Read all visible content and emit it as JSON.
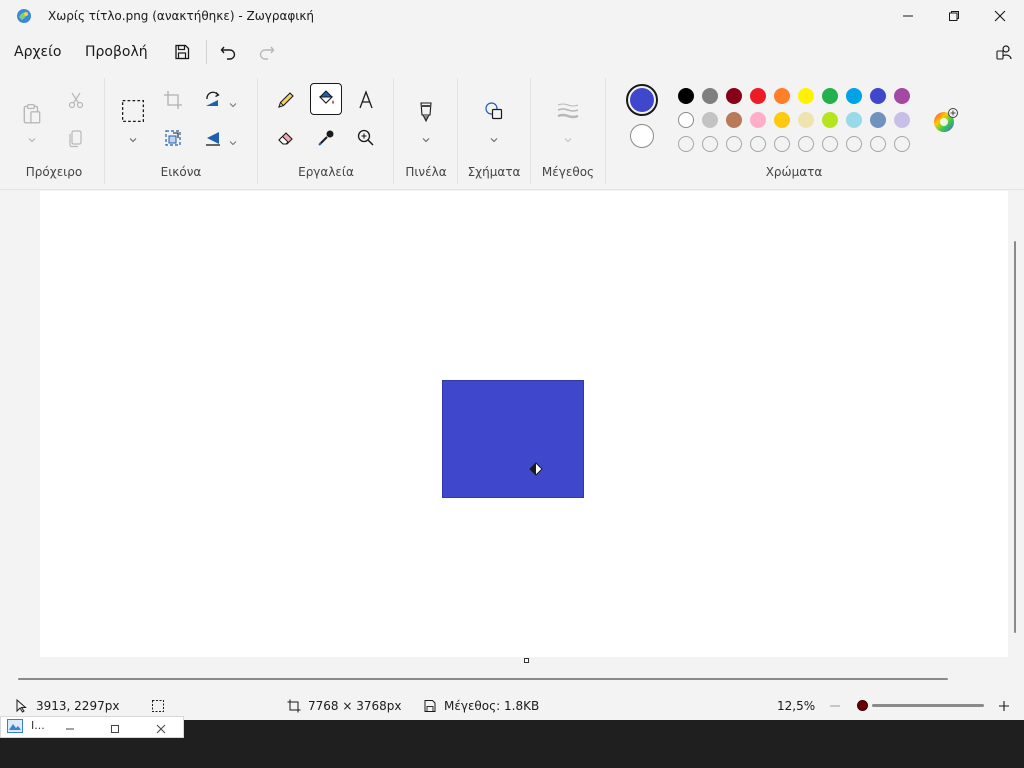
{
  "window": {
    "title": "Χωρίς τίτλο.png (ανακτήθηκε) - Ζωγραφική",
    "icons": {
      "app": "paint-app-icon",
      "minimize": "minimize-icon",
      "maximize": "restore-icon",
      "close": "close-icon"
    }
  },
  "menubar": {
    "items": [
      {
        "label": "Αρχείο"
      },
      {
        "label": "Προβολή"
      }
    ],
    "quick_actions": [
      "save-icon",
      "undo-icon",
      "redo-icon"
    ],
    "account_icon": "account-settings-icon"
  },
  "ribbon": {
    "groups": [
      {
        "label": "Πρόχειρο"
      },
      {
        "label": "Εικόνα"
      },
      {
        "label": "Εργαλεία"
      },
      {
        "label": "Πινέλα"
      },
      {
        "label": "Σχήματα"
      },
      {
        "label": "Μέγεθος"
      },
      {
        "label": "Χρώματα"
      }
    ],
    "tools": {
      "clipboard": [
        "paste-icon",
        "cut-icon",
        "copy-icon"
      ],
      "image": [
        "select-rectangle-icon",
        "crop-icon",
        "rotate-icon",
        "resize-icon",
        "flip-icon"
      ],
      "tools": [
        "pencil-icon",
        "fill-bucket-icon",
        "text-icon",
        "eraser-icon",
        "color-picker-icon",
        "magnifier-icon"
      ],
      "active_tool": "fill-bucket-icon"
    },
    "colors": {
      "primary": "#3f48cc",
      "secondary": "#ffffff",
      "row1": [
        "#000000",
        "#7f7f7f",
        "#880015",
        "#ed1c24",
        "#ff7f27",
        "#fff200",
        "#22b14c",
        "#00a2e8",
        "#3f48cc",
        "#a349a4"
      ],
      "row2": [
        "#ffffff",
        "#c3c3c3",
        "#b97a57",
        "#ffaec9",
        "#ffc90e",
        "#efe4b0",
        "#b5e61d",
        "#99d9ea",
        "#7092be",
        "#c8bfe7"
      ],
      "row3_empty": 10,
      "edit_colors_icon": "color-wheel-icon"
    }
  },
  "canvas": {
    "background": "#ffffff",
    "shape_color": "#3f48cc"
  },
  "statusbar": {
    "cursor_position": "3913, 2297px",
    "canvas_size": "7768 × 3768px",
    "file_size": "Μέγεθος: 1.8KB",
    "zoom": "12,5%",
    "zoom_fraction": 0.04
  },
  "taskbar": {
    "thumb_text": "I..."
  }
}
